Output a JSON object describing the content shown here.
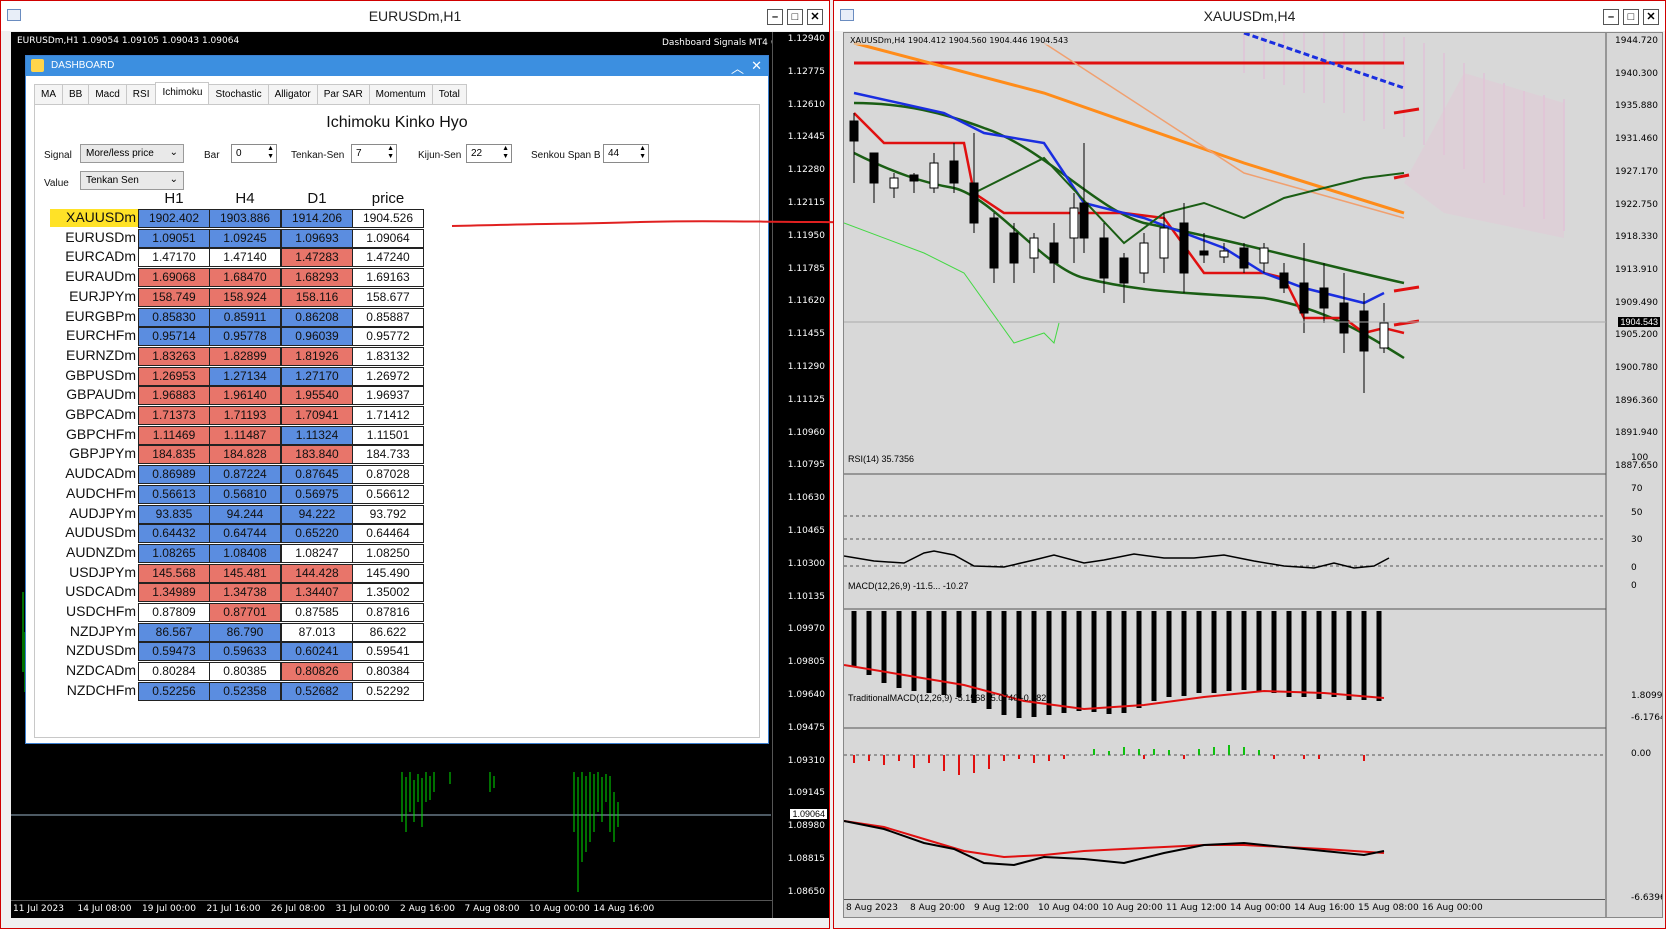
{
  "left_window": {
    "title": "EURUSDm,H1",
    "chart_header": "EURUSDm,H1  1.09054 1.09105 1.09043 1.09064",
    "indicator_label": "Dashboard Signals MT4",
    "price_ticks": [
      "1.12940",
      "1.12775",
      "1.12610",
      "1.12445",
      "1.12280",
      "1.12115",
      "1.11950",
      "1.11785",
      "1.11620",
      "1.11455",
      "1.11290",
      "1.11125",
      "1.10960",
      "1.10795",
      "1.10630",
      "1.10465",
      "1.10300",
      "1.10135",
      "1.09970",
      "1.09805",
      "1.09640",
      "1.09475",
      "1.09310",
      "1.09145",
      "1.08980",
      "1.08815",
      "1.08650"
    ],
    "current_price": "1.09064",
    "date_ticks": [
      "11 Jul 2023",
      "14 Jul 08:00",
      "19 Jul 00:00",
      "21 Jul 16:00",
      "26 Jul 08:00",
      "31 Jul 00:00",
      "2 Aug 16:00",
      "7 Aug 08:00",
      "10 Aug 00:00",
      "14 Aug 16:00"
    ]
  },
  "dashboard": {
    "title": "DASHBOARD",
    "tabs": [
      "MA",
      "BB",
      "Macd",
      "RSI",
      "Ichimoku",
      "Stochastic",
      "Alligator",
      "Par SAR",
      "Momentum",
      "Total"
    ],
    "active_tab": "Ichimoku",
    "heading": "Ichimoku Kinko Hyo",
    "controls": {
      "signal_label": "Signal",
      "signal_value": "More/less price",
      "bar_label": "Bar",
      "bar_value": "0",
      "tenkan_label": "Tenkan-Sen",
      "tenkan_value": "7",
      "kijun_label": "Kijun-Sen",
      "kijun_value": "22",
      "senkou_label": "Senkou Span B",
      "senkou_value": "44",
      "value_label": "Value",
      "value_value": "Tenkan Sen"
    },
    "columns": [
      "H1",
      "H4",
      "D1",
      "price"
    ],
    "rows": [
      {
        "symbol": "XAUUSDm",
        "highlight": true,
        "h1": "1902.402",
        "h1c": "blue",
        "h4": "1903.886",
        "h4c": "blue",
        "d1": "1914.206",
        "d1c": "blue",
        "price": "1904.526"
      },
      {
        "symbol": "EURUSDm",
        "h1": "1.09051",
        "h1c": "blue",
        "h4": "1.09245",
        "h4c": "blue",
        "d1": "1.09693",
        "d1c": "blue",
        "price": "1.09064"
      },
      {
        "symbol": "EURCADm",
        "h1": "1.47170",
        "h1c": "white",
        "h4": "1.47140",
        "h4c": "white",
        "d1": "1.47283",
        "d1c": "red",
        "price": "1.47240"
      },
      {
        "symbol": "EURAUDm",
        "h1": "1.69068",
        "h1c": "red",
        "h4": "1.68470",
        "h4c": "red",
        "d1": "1.68293",
        "d1c": "red",
        "price": "1.69163"
      },
      {
        "symbol": "EURJPYm",
        "h1": "158.749",
        "h1c": "red",
        "h4": "158.924",
        "h4c": "red",
        "d1": "158.116",
        "d1c": "red",
        "price": "158.677"
      },
      {
        "symbol": "EURGBPm",
        "h1": "0.85830",
        "h1c": "blue",
        "h4": "0.85911",
        "h4c": "blue",
        "d1": "0.86208",
        "d1c": "blue",
        "price": "0.85887"
      },
      {
        "symbol": "EURCHFm",
        "h1": "0.95714",
        "h1c": "blue",
        "h4": "0.95778",
        "h4c": "blue",
        "d1": "0.96039",
        "d1c": "blue",
        "price": "0.95772"
      },
      {
        "symbol": "EURNZDm",
        "h1": "1.83263",
        "h1c": "red",
        "h4": "1.82899",
        "h4c": "red",
        "d1": "1.81926",
        "d1c": "red",
        "price": "1.83132"
      },
      {
        "symbol": "GBPUSDm",
        "h1": "1.26953",
        "h1c": "red",
        "h4": "1.27134",
        "h4c": "blue",
        "d1": "1.27170",
        "d1c": "blue",
        "price": "1.26972"
      },
      {
        "symbol": "GBPAUDm",
        "h1": "1.96883",
        "h1c": "red",
        "h4": "1.96140",
        "h4c": "red",
        "d1": "1.95540",
        "d1c": "red",
        "price": "1.96937"
      },
      {
        "symbol": "GBPCADm",
        "h1": "1.71373",
        "h1c": "red",
        "h4": "1.71193",
        "h4c": "red",
        "d1": "1.70941",
        "d1c": "red",
        "price": "1.71412"
      },
      {
        "symbol": "GBPCHFm",
        "h1": "1.11469",
        "h1c": "red",
        "h4": "1.11487",
        "h4c": "red",
        "d1": "1.11324",
        "d1c": "blue",
        "price": "1.11501"
      },
      {
        "symbol": "GBPJPYm",
        "h1": "184.835",
        "h1c": "red",
        "h4": "184.828",
        "h4c": "red",
        "d1": "183.840",
        "d1c": "red",
        "price": "184.733"
      },
      {
        "symbol": "AUDCADm",
        "h1": "0.86989",
        "h1c": "blue",
        "h4": "0.87224",
        "h4c": "blue",
        "d1": "0.87645",
        "d1c": "blue",
        "price": "0.87028"
      },
      {
        "symbol": "AUDCHFm",
        "h1": "0.56613",
        "h1c": "blue",
        "h4": "0.56810",
        "h4c": "blue",
        "d1": "0.56975",
        "d1c": "blue",
        "price": "0.56612"
      },
      {
        "symbol": "AUDJPYm",
        "h1": "93.835",
        "h1c": "blue",
        "h4": "94.244",
        "h4c": "blue",
        "d1": "94.222",
        "d1c": "blue",
        "price": "93.792"
      },
      {
        "symbol": "AUDUSDm",
        "h1": "0.64432",
        "h1c": "blue",
        "h4": "0.64744",
        "h4c": "blue",
        "d1": "0.65220",
        "d1c": "blue",
        "price": "0.64464"
      },
      {
        "symbol": "AUDNZDm",
        "h1": "1.08265",
        "h1c": "blue",
        "h4": "1.08408",
        "h4c": "blue",
        "d1": "1.08247",
        "d1c": "white",
        "price": "1.08250"
      },
      {
        "symbol": "USDJPYm",
        "h1": "145.568",
        "h1c": "red",
        "h4": "145.481",
        "h4c": "red",
        "d1": "144.428",
        "d1c": "red",
        "price": "145.490"
      },
      {
        "symbol": "USDCADm",
        "h1": "1.34989",
        "h1c": "red",
        "h4": "1.34738",
        "h4c": "red",
        "d1": "1.34407",
        "d1c": "red",
        "price": "1.35002"
      },
      {
        "symbol": "USDCHFm",
        "h1": "0.87809",
        "h1c": "white",
        "h4": "0.87701",
        "h4c": "red",
        "d1": "0.87585",
        "d1c": "white",
        "price": "0.87816"
      },
      {
        "symbol": "NZDJPYm",
        "h1": "86.567",
        "h1c": "blue",
        "h4": "86.790",
        "h4c": "blue",
        "d1": "87.013",
        "d1c": "white",
        "price": "86.622"
      },
      {
        "symbol": "NZDUSDm",
        "h1": "0.59473",
        "h1c": "blue",
        "h4": "0.59633",
        "h4c": "blue",
        "d1": "0.60241",
        "d1c": "blue",
        "price": "0.59541"
      },
      {
        "symbol": "NZDCADm",
        "h1": "0.80284",
        "h1c": "white",
        "h4": "0.80385",
        "h4c": "white",
        "d1": "0.80826",
        "d1c": "red",
        "price": "0.80384"
      },
      {
        "symbol": "NZDCHFm",
        "h1": "0.52256",
        "h1c": "blue",
        "h4": "0.52358",
        "h4c": "blue",
        "d1": "0.52682",
        "d1c": "blue",
        "price": "0.52292"
      }
    ]
  },
  "right_window": {
    "title": "XAUUSDm,H4",
    "chart_header": "XAUUSDm,H4  1904.412 1904.560 1904.446 1904.543",
    "price_ticks": [
      "1944.720",
      "1940.300",
      "1935.880",
      "1931.460",
      "1927.170",
      "1922.750",
      "1918.330",
      "1913.910",
      "1909.490",
      "1905.200",
      "1900.780",
      "1896.360",
      "1891.940",
      "1887.650"
    ],
    "current_price": "1904.543",
    "rsi_label": "RSI(14) 35.7356",
    "rsi_ticks": [
      "100",
      "70",
      "50",
      "30",
      "0"
    ],
    "macd_label": "MACD(12,26,9) -11.5... -10.27",
    "macd_ticks": [
      "0",
      "-6.1764"
    ],
    "tmacd_label": "TraditionalMACD(12,26,9) -5.1568 -5.0740 -0.0828",
    "tmacd_ticks": [
      "1.8099",
      "0.00",
      "-6.6396"
    ],
    "date_ticks": [
      "8 Aug 2023",
      "8 Aug 20:00",
      "9 Aug 12:00",
      "10 Aug 04:00",
      "10 Aug 20:00",
      "11 Aug 12:00",
      "14 Aug 00:00",
      "14 Aug 16:00",
      "15 Aug 08:00",
      "16 Aug 00:00"
    ]
  },
  "colors": {
    "blue_cell": "#5b8de0",
    "red_cell": "#e8756a",
    "highlight": "#ffe227",
    "chart_bg_dark": "#000000",
    "chart_bg_light": "#d8d8d8",
    "window_border": "#d00000"
  }
}
